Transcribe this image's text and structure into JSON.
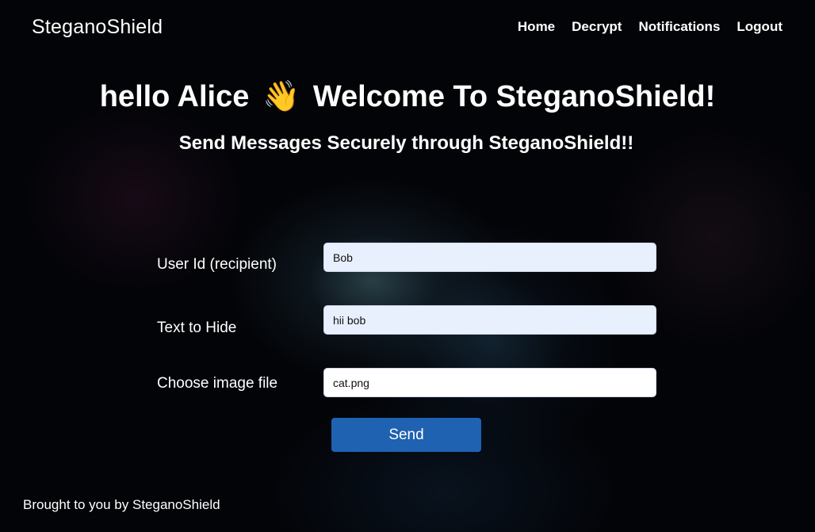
{
  "header": {
    "brand": "SteganoShield",
    "nav": {
      "home": "Home",
      "decrypt": "Decrypt",
      "notifications": "Notifications",
      "logout": "Logout"
    }
  },
  "main": {
    "greeting": "hello Alice",
    "wave_emoji": "👋",
    "welcome": "Welcome To SteganoShield!",
    "subtitle": "Send Messages Securely through SteganoShield!!"
  },
  "form": {
    "recipient_label": "User Id (recipient)",
    "recipient_value": "Bob",
    "text_label": "Text to Hide",
    "text_value": "hii bob",
    "file_label": "Choose image file",
    "file_value": "cat.png",
    "send_label": "Send"
  },
  "footer": {
    "text": "Brought to you by SteganoShield"
  },
  "colors": {
    "background": "#030408",
    "send_button": "#1e62b1",
    "autofill_field": "#e8f0fe"
  }
}
